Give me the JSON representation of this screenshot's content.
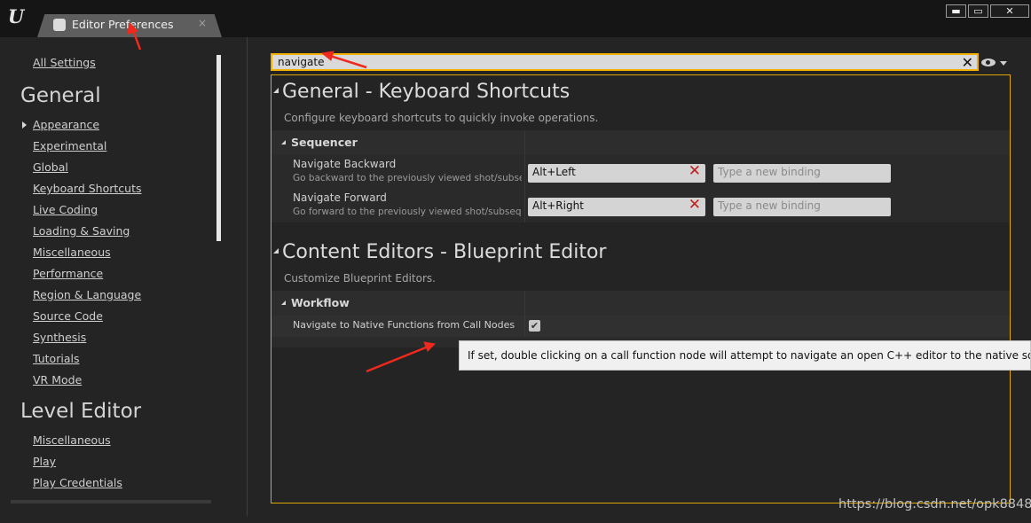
{
  "window": {
    "tab_title": "Editor Preferences",
    "tab_close": "×",
    "buttons": {
      "minimize": "▬",
      "maximize": "▭",
      "close": "✕"
    }
  },
  "sidebar": {
    "all_settings": "All Settings",
    "groups": [
      {
        "heading": "General",
        "items": [
          "Appearance",
          "Experimental",
          "Global",
          "Keyboard Shortcuts",
          "Live Coding",
          "Loading & Saving",
          "Miscellaneous",
          "Performance",
          "Region & Language",
          "Source Code",
          "Synthesis",
          "Tutorials",
          "VR Mode"
        ]
      },
      {
        "heading": "Level Editor",
        "items": [
          "Miscellaneous",
          "Play",
          "Play Credentials"
        ]
      }
    ]
  },
  "search": {
    "value": "navigate",
    "clear_glyph": "✕"
  },
  "sections": [
    {
      "title": "General - Keyboard Shortcuts",
      "description": "Configure keyboard shortcuts to quickly invoke operations.",
      "category": "Sequencer",
      "rows": [
        {
          "name": "Navigate Backward",
          "description": "Go backward to the previously viewed shot/subsequence",
          "binding": "Alt+Left",
          "new_binding_placeholder": "Type a new binding"
        },
        {
          "name": "Navigate Forward",
          "description": "Go forward to the previously viewed shot/subsequence",
          "binding": "Alt+Right",
          "new_binding_placeholder": "Type a new binding"
        }
      ]
    },
    {
      "title": "Content Editors - Blueprint Editor",
      "description": "Customize Blueprint Editors.",
      "category": "Workflow",
      "rows": [
        {
          "name": "Navigate to Native Functions from Call Nodes",
          "checked": true,
          "check_glyph": "✔"
        }
      ]
    }
  ],
  "tooltip": "If set, double clicking on a call function node will attempt to navigate an open C++ editor to the native source definition",
  "watermark": "https://blog.csdn.net/opk8848",
  "colors": {
    "focus_border": "#f0b000",
    "clear_x": "#c21f1f",
    "annotation_arrow": "#f0291e"
  }
}
